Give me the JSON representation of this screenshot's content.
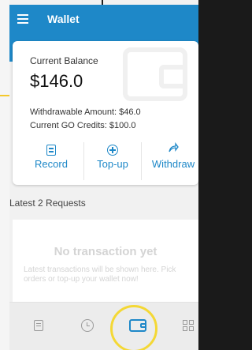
{
  "appbar": {
    "title": "Wallet",
    "menu_icon": "menu-icon"
  },
  "balance": {
    "label": "Current Balance",
    "amount": "$146.0",
    "withdrawable": "Withdrawable Amount: $46.0",
    "go_credits": "Current GO Credits: $100.0"
  },
  "actions": [
    {
      "label": "Record",
      "icon": "document-icon"
    },
    {
      "label": "Top-up",
      "icon": "plus-circle-icon"
    },
    {
      "label": "Withdraw",
      "icon": "share-arrow-icon"
    }
  ],
  "requests": {
    "title": "Latest 2 Requests",
    "empty_title": "No transaction yet",
    "empty_text": "Latest transactions will be shown here. Pick orders or top-up your wallet now!"
  },
  "bottom_nav": [
    {
      "name": "orders-list-icon"
    },
    {
      "name": "history-icon"
    },
    {
      "name": "wallet-icon",
      "active": true
    },
    {
      "name": "apps-grid-icon"
    }
  ],
  "colors": {
    "primary": "#1e88c8",
    "highlight": "#f4d835",
    "muted": "#d4d4d4"
  }
}
